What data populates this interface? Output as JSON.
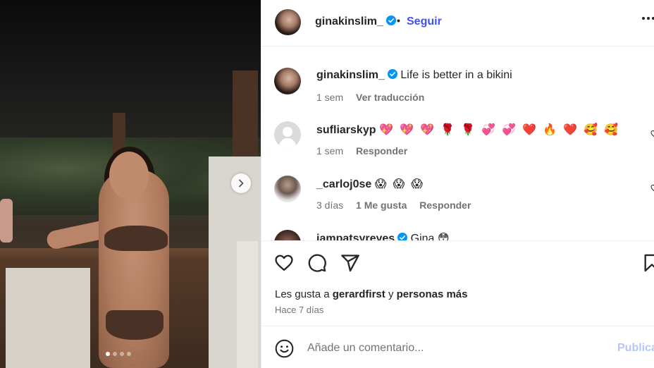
{
  "post": {
    "author": "ginakinslim_",
    "follow_label": "Seguir",
    "separator": "•",
    "caption": "Life is better in a bikini",
    "caption_age": "1 sem",
    "translate_label": "Ver traducción",
    "carousel": {
      "slides": 4,
      "active_slide": 1
    }
  },
  "comments": [
    {
      "user": "sufliarskyp",
      "text": "💖 💖 💖 🌹 🌹 💞 💞 ❤️ 🔥 ❤️ 🥰 🥰",
      "age": "1 sem",
      "likes": "",
      "reply_label": "Responder"
    },
    {
      "user": "_carloj0se",
      "text": "😱 😱 😱",
      "age": "3 días",
      "likes": "1 Me gusta",
      "reply_label": "Responder"
    },
    {
      "user": "iampatsyreyes",
      "text": "Gina 😳",
      "age": "",
      "likes": "",
      "reply_label": ""
    }
  ],
  "actions": {
    "liked_by_prefix": "Les gusta a",
    "liked_by_user": "gerardfirst",
    "liked_by_connector": "y",
    "liked_by_rest": "personas más",
    "time": "Hace 7 días"
  },
  "composer": {
    "placeholder": "Añade un comentario...",
    "publish_label": "Publicar"
  },
  "colors": {
    "accent": "#4150f7",
    "verified": "#0095f6",
    "publish_disabled": "#b3c7fb",
    "muted_text": "#737373"
  },
  "icons": [
    "chevron-right-icon",
    "verified-icon",
    "more-icon",
    "heart-icon",
    "comment-icon",
    "share-icon",
    "bookmark-icon",
    "emoji-icon"
  ]
}
